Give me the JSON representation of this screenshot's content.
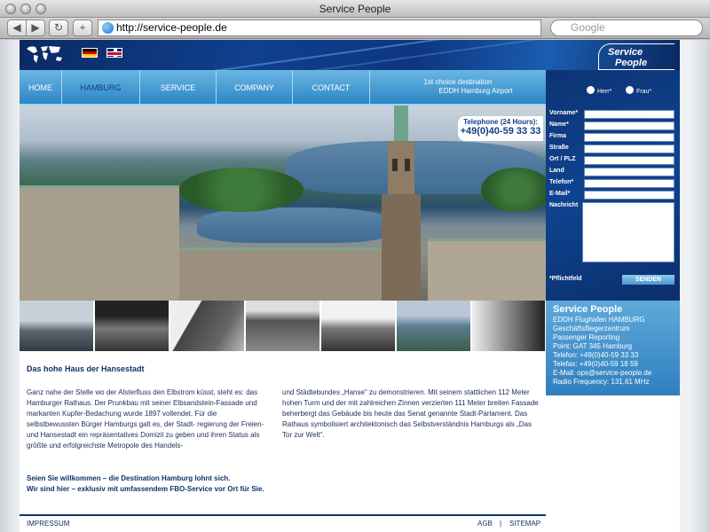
{
  "window": {
    "title": "Service People"
  },
  "toolbar": {
    "url": "http://service-people.de",
    "search_placeholder": "Google",
    "back": "◀",
    "forward": "▶",
    "reload": "↻",
    "add": "+"
  },
  "header": {
    "logo_line1": "Service",
    "logo_line2": "People"
  },
  "nav": {
    "items": [
      "HOME",
      "HAMBURG",
      "SERVICE",
      "COMPANY",
      "CONTACT"
    ],
    "active": "HAMBURG",
    "destination_line1": "1st choice destination",
    "destination_line2": "EDDH Hamburg Airport"
  },
  "hero": {
    "phone_label": "Telephone (24 Hours):",
    "phone_number": "+49(0)40-59 33 33"
  },
  "form": {
    "salutation_mr": "Herr*",
    "salutation_ms": "Frau*",
    "fields": [
      "Vorname*",
      "Name*",
      "Firma",
      "Straße",
      "Ort / PLZ",
      "Land",
      "Telefon*",
      "E-Mail*"
    ],
    "message_label": "Nachricht",
    "required_note": "*Pflichtfeld",
    "send_label": "SENDEN"
  },
  "contact": {
    "title": "Service People",
    "lines": [
      "EDDH Flughafen HAMBURG",
      "Geschäftsfliegerzentrum",
      "Passenger Reporting",
      "Point: GAT 345 Hamburg",
      "Telefon: +49(0)40-59 33 33",
      "Telefax: +49(0)40-59 18 59"
    ],
    "email_prefix": "E-Mail: ",
    "email": "ops@service-people.de",
    "radio": "Radio Frequency: 131,61 MHz"
  },
  "content": {
    "title": "Das hohe Haus der Hansestadt",
    "col1": "Ganz nahe der Stelle wo der Alsterfluss den Elbstrom küsst, steht es: das Hamburger Rathaus. Der Prunkbau mit seiner Elbsandstein-Fassade und markanten Kupfer-Bedachung wurde 1897 vollendet. Für die selbstbewussten Bürger Hamburgs galt es, der Stadt- regierung der Freien- und Hansestadt ein repräsentatives Domizil zu geben und ihren Status als größte und erfolgreichste Metropole des Handels-",
    "col2": "und Städtebundes „Hanse“ zu demonstrieren. Mit seinem stattlichen 112 Meter hohen Turm und der mit zahlreichen Zinnen verzierten 111 Meter breiten Fassade beherbergt das Gebäude bis heute das Senat genannte Stadt-Parlament. Das Rathaus symbolisiert architektonisch das Selbstverständnis Hamburgs als „Das Tor zur Welt“.",
    "welcome_line1": "Seien Sie willkommen – die Destination Hamburg lohnt sich.",
    "welcome_line2": "Wir sind hier – exklusiv mit umfassendem FBO-Service vor Ort für Sie."
  },
  "footer": {
    "impressum": "IMPRESSUM",
    "agb": "AGB",
    "sitemap": "SITEMAP",
    "separator": "|"
  }
}
